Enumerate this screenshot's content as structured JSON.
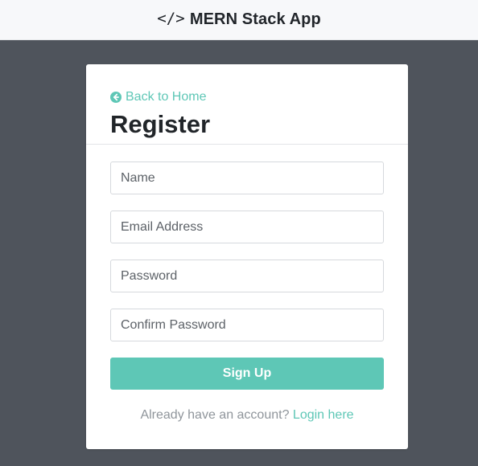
{
  "navbar": {
    "icon": "code-icon",
    "icon_glyph": "</>",
    "brand": "MERN Stack App"
  },
  "card": {
    "back_link": {
      "icon": "arrow-circle-left-icon",
      "label": "Back to Home"
    },
    "title": "Register",
    "fields": {
      "name_placeholder": "Name",
      "email_placeholder": "Email Address",
      "password_placeholder": "Password",
      "confirm_password_placeholder": "Confirm Password"
    },
    "submit_label": "Sign Up",
    "footer": {
      "prompt": "Already have an account?",
      "link_label": "Login here"
    }
  },
  "colors": {
    "page_background": "#4f545c",
    "navbar_background": "#f7f8fa",
    "accent": "#5ec7b6",
    "card_background": "#ffffff"
  }
}
